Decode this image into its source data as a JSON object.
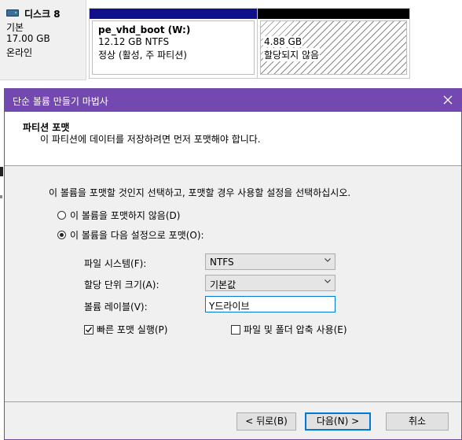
{
  "disk": {
    "name": "디스크 8",
    "type": "기본",
    "size": "17.00 GB",
    "status": "온라인",
    "icon": "disk-drive-icon"
  },
  "partitions": [
    {
      "name": "pe_vhd_boot  (W:)",
      "detail": "12.12 GB NTFS",
      "status": "정상 (활성, 주 파티션)",
      "bar_color": "#10108a"
    },
    {
      "size": "4.88 GB",
      "status": "할당되지 않음",
      "bar_color": "#000000"
    }
  ],
  "wizard": {
    "title": "단순 볼륨 만들기 마법사",
    "close_icon": "close-icon",
    "header": {
      "title": "파티션 포맷",
      "subtitle": "이 파티션에 데이터를 저장하려면 먼저 포맷해야 합니다."
    },
    "instruction": "이 볼륨을 포맷할 것인지 선택하고, 포맷할 경우 사용할 설정을 선택하십시오.",
    "radio_no_format": {
      "label": "이 볼륨을 포맷하지 않음(D)",
      "selected": false
    },
    "radio_format": {
      "label": "이 볼륨을 다음 설정으로 포맷(O):",
      "selected": true
    },
    "file_system": {
      "label": "파일 시스템(F):",
      "value": "NTFS"
    },
    "allocation_unit": {
      "label": "할당 단위 크기(A):",
      "value": "기본값"
    },
    "volume_label": {
      "label": "볼륨 레이블(V):",
      "value": "Y드라이브"
    },
    "quick_format": {
      "label": "빠른 포맷 실행(P)",
      "checked": true
    },
    "compression": {
      "label": "파일 및 폴더 압축 사용(E)",
      "checked": false
    },
    "buttons": {
      "back": "< 뒤로(B)",
      "next": "다음(N) >",
      "cancel": "취소"
    },
    "accent_color": "#7348b0"
  }
}
